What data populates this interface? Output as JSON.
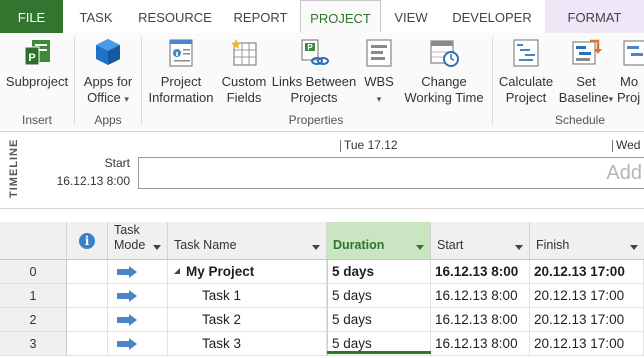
{
  "tabs": [
    "FILE",
    "TASK",
    "RESOURCE",
    "REPORT",
    "PROJECT",
    "VIEW",
    "DEVELOPER",
    "FORMAT"
  ],
  "active_tab": "PROJECT",
  "ribbon": {
    "subproject": "Subproject",
    "apps_for_office_1": "Apps for",
    "apps_for_office_2": "Office",
    "project_information_1": "Project",
    "project_information_2": "Information",
    "custom_fields_1": "Custom",
    "custom_fields_2": "Fields",
    "links_between_1": "Links Between",
    "links_between_2": "Projects",
    "wbs": "WBS",
    "change_working_time_1": "Change",
    "change_working_time_2": "Working Time",
    "calculate_project_1": "Calculate",
    "calculate_project_2": "Project",
    "set_baseline_1": "Set",
    "set_baseline_2": "Baseline",
    "move_project_1": "Mo",
    "move_project_2": "Proj",
    "groups": {
      "insert": "Insert",
      "apps": "Apps",
      "properties": "Properties",
      "schedule": "Schedule"
    }
  },
  "timeline": {
    "vertical_label": "TIMELINE",
    "start_label": "Start",
    "start_date": "16.12.13 8:00",
    "tick_1": "Tue 17.12",
    "tick_2": "Wed",
    "add_hint": "Add"
  },
  "grid": {
    "headers": {
      "mode_1": "Task",
      "mode_2": "Mode",
      "name": "Task Name",
      "duration": "Duration",
      "start": "Start",
      "finish": "Finish"
    },
    "rows": [
      {
        "id": "0",
        "name": "My Project",
        "duration": "5 days",
        "start": "16.12.13 8:00",
        "finish": "20.12.13 17:00",
        "summary": true
      },
      {
        "id": "1",
        "name": "Task 1",
        "duration": "5 days",
        "start": "16.12.13 8:00",
        "finish": "20.12.13 17:00",
        "summary": false
      },
      {
        "id": "2",
        "name": "Task 2",
        "duration": "5 days",
        "start": "16.12.13 8:00",
        "finish": "20.12.13 17:00",
        "summary": false
      },
      {
        "id": "3",
        "name": "Task 3",
        "duration": "5 days",
        "start": "16.12.13 8:00",
        "finish": "20.12.13 17:00",
        "summary": false
      }
    ]
  },
  "colors": {
    "accent": "#31752f",
    "duration_header": "#c9e5c2",
    "info": "#3a7fc9",
    "mode_icon": "#4a86c6"
  }
}
